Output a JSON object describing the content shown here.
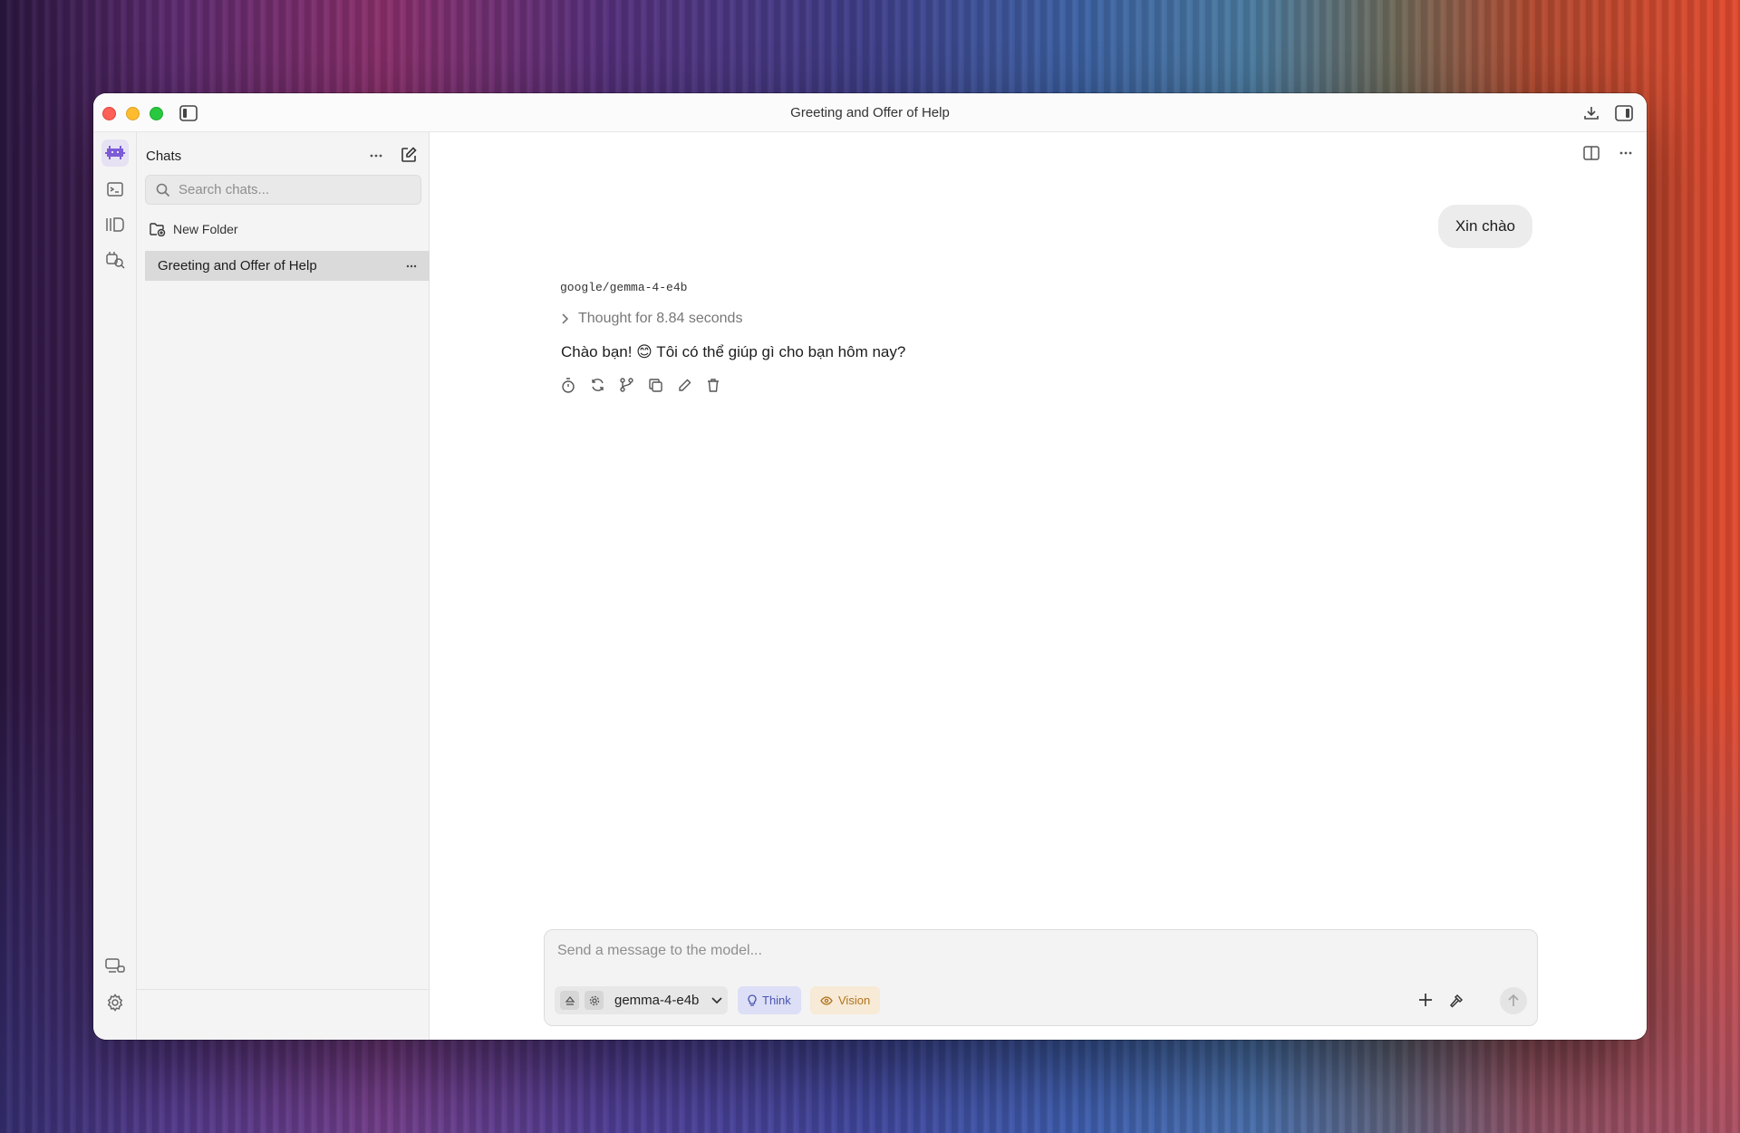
{
  "window": {
    "title": "Greeting and Offer of Help"
  },
  "rail": {
    "items": [
      {
        "icon": "bot-icon",
        "active": true
      },
      {
        "icon": "terminal-icon"
      },
      {
        "icon": "library-icon"
      },
      {
        "icon": "model-search-icon"
      }
    ],
    "bottom": [
      {
        "icon": "devices-icon"
      },
      {
        "icon": "gear-icon"
      }
    ]
  },
  "sidebar": {
    "title": "Chats",
    "search_placeholder": "Search chats...",
    "new_folder_label": "New Folder",
    "chats": [
      {
        "title": "Greeting and Offer of Help",
        "selected": true
      }
    ]
  },
  "conversation": {
    "user_message": "Xin chào",
    "model_name": "google/gemma-4-e4b",
    "thought_label": "Thought for 8.84 seconds",
    "reply_text": "Chào bạn! 😊 Tôi có thể giúp gì cho bạn hôm nay?",
    "actions": [
      "stopwatch-icon",
      "regenerate-icon",
      "branch-icon",
      "copy-icon",
      "edit-icon",
      "delete-icon"
    ]
  },
  "composer": {
    "placeholder": "Send a message to the model...",
    "model_selected": "gemma-4-e4b",
    "think_label": "Think",
    "vision_label": "Vision"
  },
  "colors": {
    "accent": "#7b5cd6",
    "think_bg": "#dcdff5",
    "vision_bg": "#f7ead6"
  }
}
